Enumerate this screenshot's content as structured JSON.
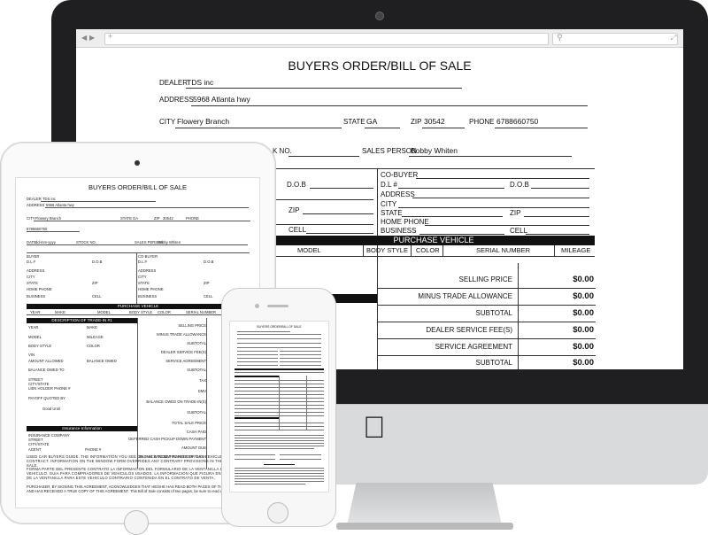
{
  "form": {
    "title": "BUYERS ORDER/BILL OF SALE",
    "dealer_label": "DEALER",
    "dealer_value": "TDS inc",
    "address_label": "ADDRESS",
    "address_value": "5968 Atlanta hwy",
    "city_label": "CITY",
    "city_value": "Flowery Branch",
    "state_label": "STATE",
    "state_value": "GA",
    "zip_label": "ZIP",
    "zip_value": "30542",
    "phone_label": "PHONE",
    "phone_value": "6788660750",
    "stock_label": "K NO.",
    "salesperson_label": "SALES PERSON",
    "salesperson_value": "Bobby Whiten",
    "dob_label": "D.O.B",
    "zip2_label": "ZIP",
    "cell_label": "CELL",
    "cobuyer_label": "CO-BUYER",
    "dl_label": "D.L #",
    "cob_dob_label": "D.O.B",
    "cob_address_label": "ADDRESS",
    "cob_city_label": "CITY",
    "cob_state_label": "STATE",
    "cob_zip_label": "ZIP",
    "cob_homephone_label": "HOME PHONE",
    "cob_business_label": "BUSINESS",
    "cob_cell_label": "CELL",
    "purchase_vehicle": "PURCHASE VEHICLE",
    "vehicle_columns": [
      "MODEL",
      "BODY STYLE",
      "COLOR",
      "SERIAL NUMBER",
      "MILEAGE"
    ],
    "pricing": [
      {
        "label": "SELLING PRICE",
        "value": "$0.00"
      },
      {
        "label": "MINUS TRADE ALLOWANCE",
        "value": "$0.00"
      },
      {
        "label": "SUBTOTAL",
        "value": "$0.00"
      },
      {
        "label": "DEALER SERVICE FEE(S)",
        "value": "$0.00"
      },
      {
        "label": "SERVICE AGREEMENT",
        "value": "$0.00"
      },
      {
        "label": "SUBTOTAL",
        "value": "$0.00"
      }
    ]
  },
  "tablet": {
    "title": "BUYERS ORDER/BILL OF SALE",
    "dealer": "DEALER",
    "dealer_value": "TDS inc",
    "address": "ADDRESS",
    "address_value": "5968 Atlanta hwy",
    "city": "CITY",
    "city_value": "Flowery Branch",
    "state": "STATE",
    "state_value": "GA",
    "zip": "ZIP",
    "zip_value": "30542",
    "phone": "PHONE",
    "phone_value": "6788660750",
    "date": "DATE",
    "date_value": "dd-mm-yyyy",
    "stock": "STOCK NO.",
    "salesperson": "SALES PERSON",
    "salesperson_value": "Bobby Whiten",
    "buyer": "BUYER",
    "dl": "D.L #",
    "dob": "D.O.B",
    "addr2": "ADDRESS",
    "city2": "CITY",
    "state2": "STATE",
    "zip2": "ZIP",
    "homephone": "HOME PHONE",
    "business": "BUSINESS",
    "cell": "CELL",
    "cobuyer": "CO-BUYER",
    "purchase_vehicle": "PURCHASE VEHICLE",
    "vcols": [
      "YEAR",
      "MAKE",
      "MODEL",
      "BODY STYLE",
      "COLOR",
      "SERIAL NUMBER"
    ],
    "trade_in": "DESCRIPTION OF TRADE-IN #1",
    "trade_rows": [
      "YEAR",
      "MODEL",
      "BODY STYLE",
      "VIN",
      "AMOUNT ALLOWED",
      "BALANCE OWED TO",
      "STREET",
      "CITY/STATE",
      "LIEN HOLDER PHONE #",
      "PAYOFF QUOTED BY",
      "Good Until"
    ],
    "trade_rows2": [
      "MAKE",
      "MILEAGE",
      "COLOR",
      "BALANCE OWED"
    ],
    "price_rows": [
      "SELLING PRICE",
      "MINUS TRADE ALLOWANCE",
      "SUBTOTAL",
      "DEALER SERVICE FEE(S)",
      "SERVICE AGREEMENT",
      "SUBTOTAL",
      "TAX",
      "DMV",
      "BALANCE OWED ON TRADE-IN(S)",
      "SUBTOTAL",
      "TOTAL SALE PRICE",
      "CASH PAID",
      "DEFERRED CASH PICKUP DOWN PAYMENT",
      "AMOUNT DUE",
      "BALANCE TO BE FINANCED OR CASH"
    ],
    "insurance": "Insurance Information",
    "ins_rows": [
      "INSURANCE COMPANY",
      "STREET",
      "CITY/STATE",
      "AGENT"
    ],
    "ins_phone": "PHONE #",
    "footer1": "USED CAR BUYERS GUIDE. THE INFORMATION YOU SEE ON THE WINDOW FORM FOR THIS VEHICLE IS PART OF THIS CONTRACT. INFORMATION ON THE WINDOW FORM OVERRIDES ANY CONTRARY PROVISIONS IN THE CONTRACT OF SALE.",
    "footer2": "FORMA PARTE DEL PRESENTE CONTRATO LA INFORMACION DEL FORMULARIO DE LA VENTANILLA DE ESTE VEHICULO. GUIA PARA COMPRADORES DE VEHICULOS USADOS. LA INFORMACION QUE FIGURA EN EL FORMULARIO DE LA VENTANILLA PARA ESTE VEHICULO CONTRARIO CONTENIDA EN EL CONTRATO DE VENTA.",
    "footer3": "PURCHASER, BY SIGNING THIS AGREEMENT, ACKNOWLEDGES THAT HE/SHE HAS READ BOTH PAGES OF THIS AGREEMENT AND HAS RECEIVED A TRUE COPY OF THIS AGREEMENT. This Bill of Sale consists of two pages, be sure to read and sign both."
  },
  "phone": {
    "title": "BUYERS ORDER/BILL OF SALE"
  },
  "browser": {
    "back": "◀",
    "forward": "▶",
    "add_tab": "+",
    "search_icon": "⚲",
    "expand_icon": "⤢"
  }
}
